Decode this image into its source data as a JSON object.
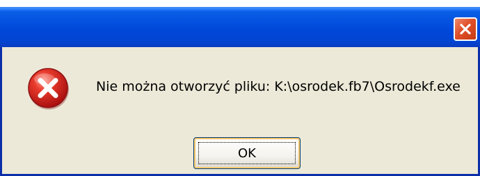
{
  "dialog": {
    "title": "",
    "message": "Nie można otworzyć pliku: K:\\osrodek.fb7\\Osrodekf.exe",
    "ok_label": "OK",
    "icon": "error-icon",
    "close_icon": "close-icon"
  },
  "colors": {
    "titlebar": "#0553e0",
    "window_bg": "#ece9d8",
    "close_button": "#e0502a",
    "error_red": "#d81e1e"
  }
}
